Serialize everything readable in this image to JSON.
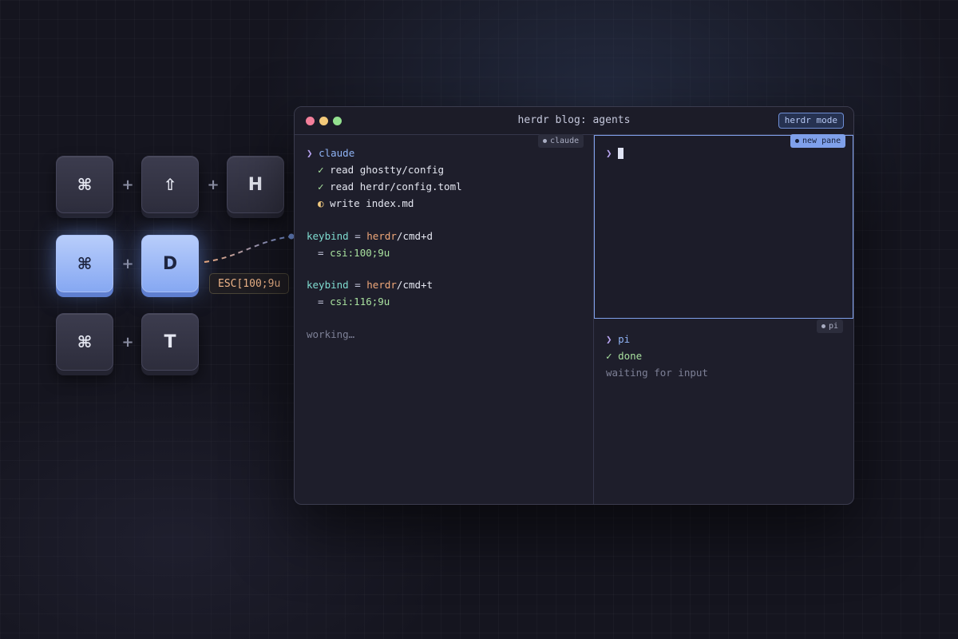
{
  "keys": {
    "row1": [
      "⌘",
      "⇧",
      "H"
    ],
    "row2": [
      "⌘",
      "D"
    ],
    "row3": [
      "⌘",
      "T"
    ],
    "plus": "+",
    "escape_label": "ESC[100;9u"
  },
  "window": {
    "title": "herdr blog: agents",
    "mode_button": "herdr mode",
    "tags": {
      "claude": "claude",
      "new_pane": "new pane",
      "pi": "pi"
    }
  },
  "left_pane": {
    "prompt_symbol": "❯",
    "agent": "claude",
    "tasks": [
      {
        "mark": "✓",
        "text": "read ghostty/config"
      },
      {
        "mark": "✓",
        "text": "read herdr/config.toml"
      },
      {
        "mark": "◐",
        "text": "write index.md"
      }
    ],
    "bindings": [
      {
        "key": "keybind",
        "eq": "=",
        "path_a": "herdr",
        "path_b": "/cmd+d",
        "csi": "csi:100;9u"
      },
      {
        "key": "keybind",
        "eq": "=",
        "path_a": "herdr",
        "path_b": "/cmd+t",
        "csi": "csi:116;9u"
      }
    ],
    "status": "working…"
  },
  "right_pane": {
    "top_prompt": "❯",
    "bottom_prompt": "❯",
    "agent": "pi",
    "done_mark": "✓",
    "done_text": "done",
    "status": "waiting for input"
  },
  "colors": {
    "accent": "#7fa0ea",
    "key_active": "#9db7f6",
    "escape_text": "#f0b68a"
  }
}
